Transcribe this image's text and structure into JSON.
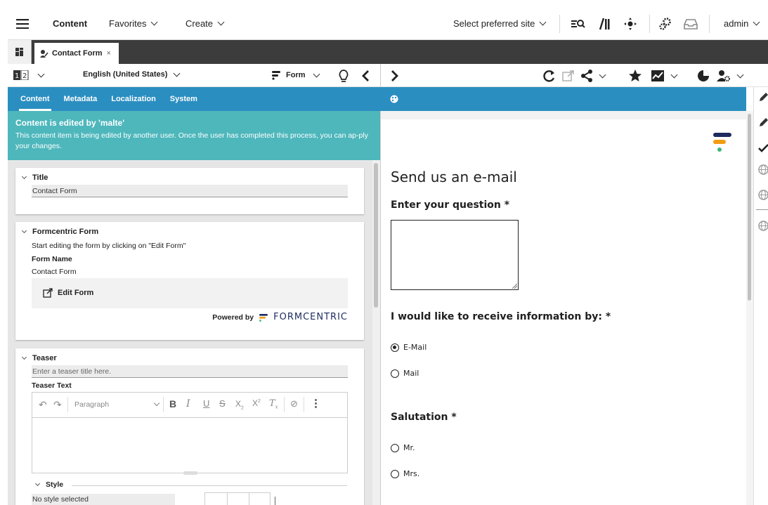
{
  "topbar": {
    "menu_icon": "hamburger-menu-icon",
    "app_label": "Content",
    "favorites_label": "Favorites",
    "create_label": "Create",
    "site_selector_label": "Select preferred site",
    "user_label": "admin"
  },
  "tabs": [
    {
      "label": "Contact Form",
      "icon": "form-document-icon",
      "close": "×"
    }
  ],
  "left_toolbar": {
    "locale_label": "English (United States)",
    "type_label": "Form"
  },
  "sub_tabs": [
    "Content",
    "Metadata",
    "Localization",
    "System"
  ],
  "notice": {
    "title": "Content is edited by 'malte'",
    "body": "This content item is being edited by another user. Once the user has completed this process, you can ap-ply your changes."
  },
  "cards": {
    "title_card": {
      "header": "Title",
      "value": "Contact Form"
    },
    "form_card": {
      "header": "Formcentric Form",
      "hint": "Start editing the form by clicking on \"Edit Form\"",
      "form_name_label": "Form Name",
      "form_name_value": "Contact Form",
      "edit_button": "Edit Form",
      "powered_by": "Powered by",
      "brand": "FORMCENTRIC"
    },
    "teaser_card": {
      "header": "Teaser",
      "title_placeholder": "Enter a teaser title here.",
      "teaser_text_label": "Teaser Text",
      "paragraph_label": "Paragraph",
      "style_label": "Style",
      "style_value": "No style selected"
    }
  },
  "preview": {
    "heading": "Send us an e-mail",
    "question_label": "Enter your question *",
    "info_label": "I would like to receive information by: *",
    "info_options": [
      {
        "label": "E-Mail",
        "selected": true
      },
      {
        "label": "Mail",
        "selected": false
      }
    ],
    "salutation_label": "Salutation *",
    "salutation_options": [
      {
        "label": "Mr.",
        "selected": false
      },
      {
        "label": "Mrs.",
        "selected": false
      }
    ]
  },
  "colors": {
    "topbar_bg": "#ffffff",
    "tabstrip_bg": "#3c3c3c",
    "accent_blue": "#2b8ec0",
    "notice_teal": "#4db7bc",
    "brand_navy": "#1d2b5f",
    "brand_orange": "#f39c12",
    "brand_green": "#3cb878"
  }
}
